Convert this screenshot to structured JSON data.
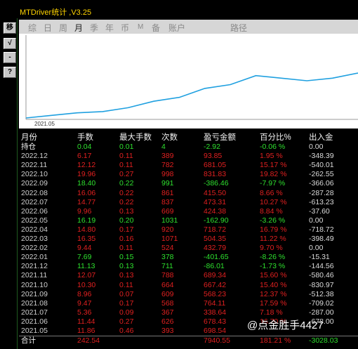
{
  "window": {
    "title": "MTDriver统计 ,V3.25"
  },
  "side_buttons": [
    {
      "label": "移"
    },
    {
      "label": "√"
    },
    {
      "label": "-"
    },
    {
      "label": "?"
    }
  ],
  "tabs": [
    {
      "label": "综"
    },
    {
      "label": "日"
    },
    {
      "label": "周"
    },
    {
      "label": "月",
      "active": true
    },
    {
      "label": "季"
    },
    {
      "label": "年"
    },
    {
      "label": "币"
    },
    {
      "label": "M"
    },
    {
      "label": "备"
    },
    {
      "label": "账户"
    },
    {
      "label": "路径"
    }
  ],
  "chart": {
    "x_tick": "2021.05",
    "line_color": "#1fa0e0",
    "series": [
      0,
      2,
      4,
      5,
      8,
      13,
      16,
      23,
      26,
      33,
      31,
      29,
      31,
      35
    ]
  },
  "table": {
    "headers": [
      "月份",
      "手数",
      "最大手数",
      "次数",
      "盈亏金额",
      "百分比%",
      "出入金"
    ],
    "holding": {
      "label": "持仓",
      "lots": "0.04",
      "max": "0.01",
      "count": "4",
      "pnl": "-2.92",
      "pct": "-0.06 %",
      "flow": "0.00"
    },
    "rows": [
      {
        "m": "2022.12",
        "lots": "6.17",
        "max": "0.11",
        "cnt": "389",
        "pnl": "93.85",
        "pct": "1.95 %",
        "flow": "-348.39",
        "neg": false
      },
      {
        "m": "2022.11",
        "lots": "12.12",
        "max": "0.11",
        "cnt": "782",
        "pnl": "681.05",
        "pct": "15.17 %",
        "flow": "-540.01",
        "neg": false
      },
      {
        "m": "2022.10",
        "lots": "19.96",
        "max": "0.27",
        "cnt": "998",
        "pnl": "831.83",
        "pct": "19.82 %",
        "flow": "-262.55",
        "neg": false
      },
      {
        "m": "2022.09",
        "lots": "18.40",
        "max": "0.22",
        "cnt": "991",
        "pnl": "-386.46",
        "pct": "-7.97 %",
        "flow": "-366.06",
        "neg": true
      },
      {
        "m": "2022.08",
        "lots": "16.06",
        "max": "0.22",
        "cnt": "861",
        "pnl": "415.50",
        "pct": "8.66 %",
        "flow": "-287.28",
        "neg": false
      },
      {
        "m": "2022.07",
        "lots": "14.77",
        "max": "0.22",
        "cnt": "837",
        "pnl": "473.31",
        "pct": "10.27 %",
        "flow": "-613.23",
        "neg": false
      },
      {
        "m": "2022.06",
        "lots": "9.96",
        "max": "0.13",
        "cnt": "669",
        "pnl": "424.38",
        "pct": "8.84 %",
        "flow": "-37.60",
        "neg": false
      },
      {
        "m": "2022.05",
        "lots": "16.19",
        "max": "0.20",
        "cnt": "1031",
        "pnl": "-162.90",
        "pct": "-3.26 %",
        "flow": "0.00",
        "neg": true
      },
      {
        "m": "2022.04",
        "lots": "14.80",
        "max": "0.17",
        "cnt": "920",
        "pnl": "718.72",
        "pct": "16.79 %",
        "flow": "-718.72",
        "neg": false
      },
      {
        "m": "2022.03",
        "lots": "16.35",
        "max": "0.16",
        "cnt": "1071",
        "pnl": "504.35",
        "pct": "11.22 %",
        "flow": "-398.49",
        "neg": false
      },
      {
        "m": "2022.02",
        "lots": "9.44",
        "max": "0.11",
        "cnt": "524",
        "pnl": "432.79",
        "pct": "9.70 %",
        "flow": "0.00",
        "neg": false
      },
      {
        "m": "2022.01",
        "lots": "7.69",
        "max": "0.15",
        "cnt": "378",
        "pnl": "-401.65",
        "pct": "-8.26 %",
        "flow": "-15.31",
        "neg": true
      },
      {
        "m": "2021.12",
        "lots": "11.13",
        "max": "0.13",
        "cnt": "711",
        "pnl": "-86.01",
        "pct": "-1.73 %",
        "flow": "-144.56",
        "neg": true
      },
      {
        "m": "2021.11",
        "lots": "12.07",
        "max": "0.13",
        "cnt": "788",
        "pnl": "689.34",
        "pct": "15.60 %",
        "flow": "-580.46",
        "neg": false
      },
      {
        "m": "2021.10",
        "lots": "10.30",
        "max": "0.11",
        "cnt": "664",
        "pnl": "667.42",
        "pct": "15.40 %",
        "flow": "-830.97",
        "neg": false
      },
      {
        "m": "2021.09",
        "lots": "8.96",
        "max": "0.07",
        "cnt": "609",
        "pnl": "568.23",
        "pct": "12.37 %",
        "flow": "-512.38",
        "neg": false
      },
      {
        "m": "2021.08",
        "lots": "9.47",
        "max": "0.17",
        "cnt": "568",
        "pnl": "764.11",
        "pct": "17.59 %",
        "flow": "-709.02",
        "neg": false
      },
      {
        "m": "2021.07",
        "lots": "5.36",
        "max": "0.09",
        "cnt": "367",
        "pnl": "338.64",
        "pct": "7.18 %",
        "flow": "-287.00",
        "neg": false
      },
      {
        "m": "2021.06",
        "lots": "11.44",
        "max": "0.27",
        "cnt": "626",
        "pnl": "678.43",
        "pct": "16.70 %",
        "flow": "-678.00",
        "neg": false
      },
      {
        "m": "2021.05",
        "lots": "11.86",
        "max": "0.46",
        "cnt": "393",
        "pnl": "698.54",
        "pct": "",
        "flow": "",
        "neg": false
      }
    ],
    "total": {
      "label": "合计",
      "lots": "242.54",
      "pnl": "7940.55",
      "pct": "181.21 %",
      "flow": "-3028.03"
    }
  },
  "watermark": "@点金胜手4427"
}
